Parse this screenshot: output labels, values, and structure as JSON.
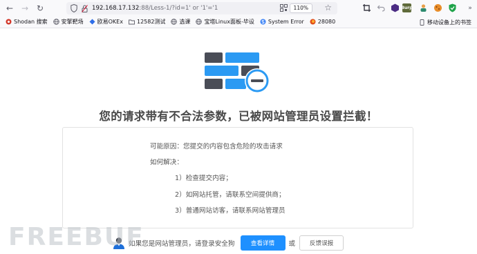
{
  "browser": {
    "url_host": "192.168.17.132",
    "url_rest": ":88/Less-1/?id=1' or '1'='1",
    "zoom": "110%"
  },
  "bookmarks": [
    {
      "label": "Shodan 搜索",
      "icon_color": "#d33a2c"
    },
    {
      "label": "安擎靶场",
      "icon": "globe-icon"
    },
    {
      "label": "欧易OKEx",
      "icon_color": "#2f6ee8"
    },
    {
      "label": "12582测试",
      "icon": "folder-icon"
    },
    {
      "label": "选课",
      "icon": "globe-icon"
    },
    {
      "label": "宝塔Linux面板-毕设",
      "icon": "globe-icon"
    },
    {
      "label": "System Error",
      "icon_color": "#3b82f6"
    },
    {
      "label": "28080",
      "icon_color": "#e04e1b"
    }
  ],
  "bookmarks_right": "移动设备上的书签",
  "page": {
    "headline": "您的请求带有不合法参数，已被网站管理员设置拦截！",
    "reason": "可能原因：您提交的内容包含危险的攻击请求",
    "how_to": "如何解决：",
    "steps": [
      "1）检查提交内容；",
      "2）如网站托管，请联系空间提供商；",
      "3）普通网站访客，请联系网站管理员"
    ],
    "admin_prompt": "如果您是网站管理员，请登录安全狗",
    "detail_button": "查看详情",
    "or_text": "或",
    "feedback_button": "反馈误报"
  },
  "watermark": "FREEBUF",
  "colors": {
    "accent_blue": "#1e90ff",
    "logo_dark": "#4a4d57",
    "logo_blue": "#2b9af3"
  }
}
